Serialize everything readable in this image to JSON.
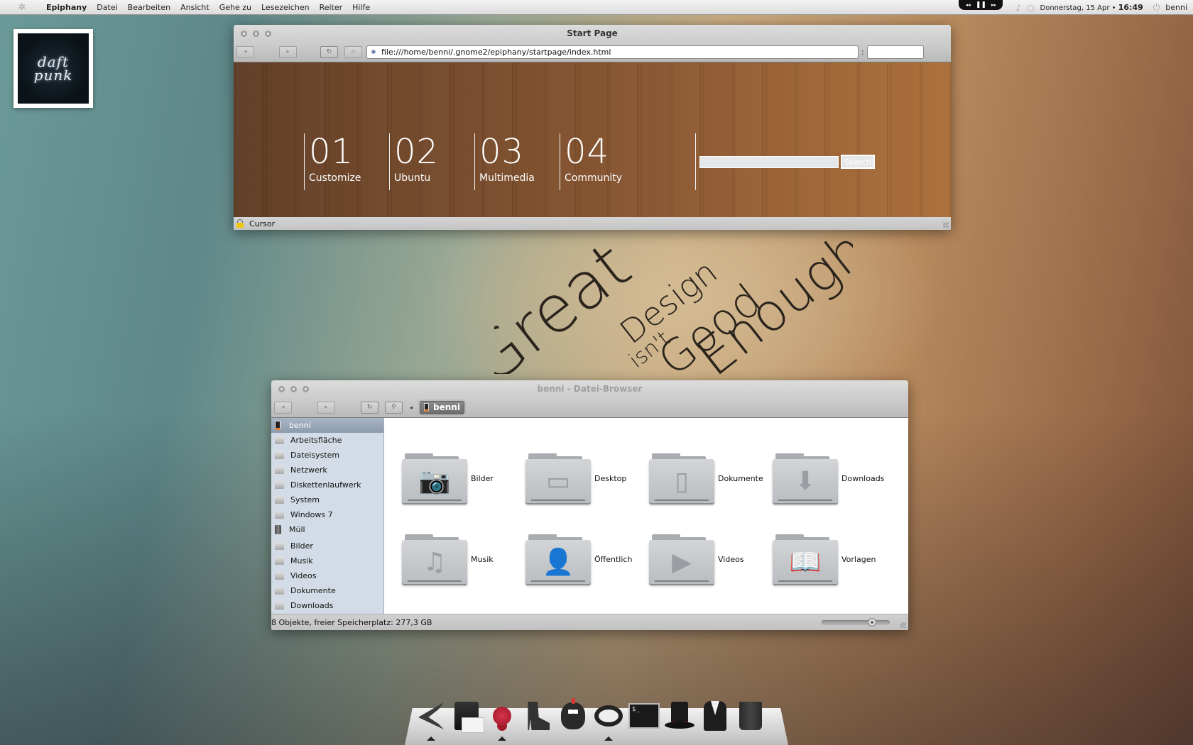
{
  "top_panel": {
    "logo_icon": "ubuntu-logo-icon",
    "app_name": "Epiphany",
    "menus": [
      "Datei",
      "Bearbeiten",
      "Ansicht",
      "Gehe zu",
      "Lesezeichen",
      "Reiter",
      "Hilfe"
    ],
    "media": {
      "prev": "◂◂",
      "pause": "❚❚",
      "next": "▸▸"
    },
    "music_icon": "♪",
    "chat_icon": "○",
    "date": "Donnerstag, 15 Apr",
    "bullet": "•",
    "time": "16:49",
    "power_icon": "⏻",
    "user": "benni"
  },
  "desktop": {
    "photo_widget": {
      "line1": "daft",
      "line2": "punk"
    },
    "wallpaper_text": {
      "w1": "Great",
      "w2": "Design",
      "w3": "isn't",
      "w4": "Good",
      "w5": "Enough"
    }
  },
  "browser": {
    "title": "Start Page",
    "back_icon": "◂",
    "forward_icon": "▸",
    "reload_icon": "↻",
    "home_icon": "⌂",
    "url": "file:///home/benni/.gnome2/epiphany/startpage/index.html",
    "url_separator": ":",
    "search_value": "",
    "page": {
      "tiles": [
        {
          "num": "01",
          "label": "Customize"
        },
        {
          "num": "02",
          "label": "Ubuntu"
        },
        {
          "num": "03",
          "label": "Multimedia"
        },
        {
          "num": "04",
          "label": "Community"
        }
      ],
      "search_placeholder": "",
      "search_button": "Search"
    },
    "status_text": "Cursor"
  },
  "file_browser": {
    "title": "benni - Datei-Browser",
    "back_icon": "◂",
    "forward_icon": "▸",
    "reload_icon": "↻",
    "search_icon": "⚲",
    "path_left_icon": "◂",
    "breadcrumb": "benni",
    "sidebar": [
      {
        "label": "benni",
        "icon": "home-device-icon",
        "selected": true
      },
      {
        "label": "Arbeitsfläche",
        "icon": "desktop-icon"
      },
      {
        "label": "Dateisystem",
        "icon": "drive-icon"
      },
      {
        "label": "Netzwerk",
        "icon": "network-icon"
      },
      {
        "label": "Diskettenlaufwerk",
        "icon": "drive-icon"
      },
      {
        "label": "System",
        "icon": "drive-icon"
      },
      {
        "label": "Windows 7",
        "icon": "drive-icon"
      },
      {
        "label": "Müll",
        "icon": "trash-icon"
      },
      {
        "label": "Bilder",
        "icon": "pictures-folder-icon"
      },
      {
        "label": "Musik",
        "icon": "music-folder-icon"
      },
      {
        "label": "Videos",
        "icon": "videos-folder-icon"
      },
      {
        "label": "Dokumente",
        "icon": "documents-folder-icon"
      },
      {
        "label": "Downloads",
        "icon": "downloads-folder-icon"
      }
    ],
    "items": [
      {
        "name": "Bilder",
        "glyph": "📷"
      },
      {
        "name": "Desktop",
        "glyph": "▭"
      },
      {
        "name": "Dokumente",
        "glyph": "▯"
      },
      {
        "name": "Downloads",
        "glyph": "⬇"
      },
      {
        "name": "Musik",
        "glyph": "♫"
      },
      {
        "name": "Öffentlich",
        "glyph": "👤"
      },
      {
        "name": "Videos",
        "glyph": "▶"
      },
      {
        "name": "Vorlagen",
        "glyph": "📖"
      }
    ],
    "status": "8 Objekte, freier Speicherplatz: 277,3 GB",
    "zoom_level": 0.78
  },
  "dock": {
    "items": [
      {
        "name": "impossible-triangle",
        "running": true
      },
      {
        "name": "mail",
        "running": false
      },
      {
        "name": "ribbon",
        "running": true
      },
      {
        "name": "boot",
        "running": false
      },
      {
        "name": "bird",
        "running": false
      },
      {
        "name": "headphones",
        "running": true
      },
      {
        "name": "terminal",
        "running": false,
        "text": "$_"
      },
      {
        "name": "top-hat",
        "running": false
      },
      {
        "name": "suit",
        "running": false
      },
      {
        "name": "trash",
        "running": false
      }
    ]
  }
}
